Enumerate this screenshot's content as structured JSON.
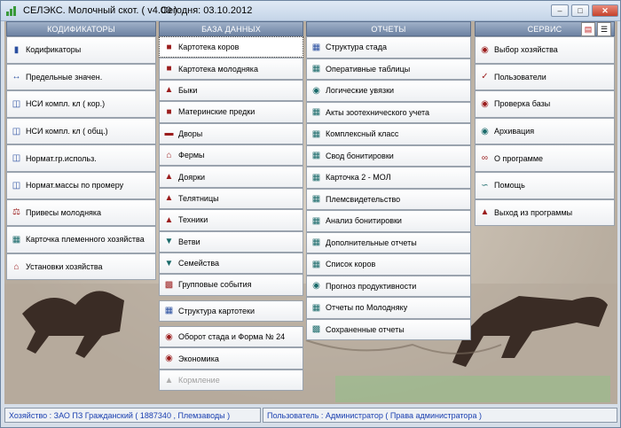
{
  "window": {
    "title": "СЕЛЭКС. Молочный скот. ( v4.00 )",
    "date": "Сегодня: 03.10.2012"
  },
  "columns": {
    "kodifikatory": {
      "header": "КОДИФИКАТОРЫ",
      "items": [
        {
          "label": "Кодификаторы",
          "icon": "books-icon"
        },
        {
          "label": "Предельные значен.",
          "icon": "range-icon"
        },
        {
          "label": "НСИ компл. кл ( кор.)",
          "icon": "book-icon"
        },
        {
          "label": "НСИ компл. кл ( общ.)",
          "icon": "book-icon"
        },
        {
          "label": "Нормат.гр.использ.",
          "icon": "book-icon"
        },
        {
          "label": "Нормат.массы по промеру",
          "icon": "book-icon"
        },
        {
          "label": "Привесы молодняка",
          "icon": "scales-icon"
        },
        {
          "label": "Карточка племенного хозяйства",
          "icon": "card-icon"
        },
        {
          "label": "Установки хозяйства",
          "icon": "farm-icon"
        }
      ]
    },
    "baza": {
      "header": "БАЗА ДАННЫХ",
      "items": [
        {
          "label": "Картотека коров",
          "icon": "cow-icon"
        },
        {
          "label": "Картотека молодняка",
          "icon": "calf-icon"
        },
        {
          "label": "Быки",
          "icon": "bull-icon"
        },
        {
          "label": "Материнские предки",
          "icon": "ancestors-icon"
        },
        {
          "label": "Дворы",
          "icon": "yard-icon"
        },
        {
          "label": "Фермы",
          "icon": "farm-icon"
        },
        {
          "label": "Доярки",
          "icon": "milkmaid-icon"
        },
        {
          "label": "Телятницы",
          "icon": "calf-keeper-icon"
        },
        {
          "label": "Техники",
          "icon": "technician-icon"
        },
        {
          "label": "Ветви",
          "icon": "branch-icon"
        },
        {
          "label": "Семейства",
          "icon": "family-icon"
        },
        {
          "label": "Групповые события",
          "icon": "group-events-icon"
        }
      ],
      "items2": [
        {
          "label": "Структура картотеки",
          "icon": "structure-icon"
        }
      ],
      "items3": [
        {
          "label": "Оборот стада и Форма № 24",
          "icon": "turnover-icon"
        },
        {
          "label": "Экономика",
          "icon": "economy-icon"
        },
        {
          "label": "Кормление",
          "icon": "feeding-icon"
        }
      ]
    },
    "otchety": {
      "header": "ОТЧЕТЫ",
      "items": [
        {
          "label": "Структура стада",
          "icon": "herd-structure-icon"
        },
        {
          "label": "Оперативные таблицы",
          "icon": "table-icon"
        },
        {
          "label": "Логические увязки",
          "icon": "logic-icon"
        },
        {
          "label": "Акты зоотехнического учета",
          "icon": "document-icon"
        },
        {
          "label": "Комплексный класс",
          "icon": "class-icon"
        },
        {
          "label": "Свод бонитировки",
          "icon": "summary-icon"
        },
        {
          "label": "Карточка 2 - МОЛ",
          "icon": "card-icon"
        },
        {
          "label": "Племсвидетельство",
          "icon": "certificate-icon"
        },
        {
          "label": "Анализ бонитировки",
          "icon": "analysis-icon"
        },
        {
          "label": "Дополнительные отчеты",
          "icon": "reports-icon"
        },
        {
          "label": "Список коров",
          "icon": "list-icon"
        },
        {
          "label": "Прогноз продуктивности",
          "icon": "forecast-icon"
        },
        {
          "label": "Отчеты по Молодняку",
          "icon": "young-report-icon"
        },
        {
          "label": "Сохраненные отчеты",
          "icon": "save-icon"
        }
      ]
    },
    "servis": {
      "header": "СЕРВИС",
      "items": [
        {
          "label": "Выбор хозяйства",
          "icon": "select-farm-icon"
        },
        {
          "label": "Пользователи",
          "icon": "users-icon"
        },
        {
          "label": "Проверка базы",
          "icon": "check-db-icon"
        },
        {
          "label": "Архивация",
          "icon": "archive-icon"
        },
        {
          "label": "О программе",
          "icon": "about-icon"
        },
        {
          "label": "Помощь",
          "icon": "help-icon"
        },
        {
          "label": "Выход из программы",
          "icon": "exit-icon"
        }
      ]
    }
  },
  "status": {
    "farm": "Хозяйство : ЗАО ПЗ Гражданский ( 1887340 , Племзаводы )",
    "user": "Пользователь : Администратор ( Права администратора )"
  },
  "colors": {
    "header_top": "#9fb0c8",
    "header_bottom": "#6e83a3",
    "status_text": "#1a3fb0",
    "icon_red": "#9b1d1d",
    "icon_blue": "#2a4fa0",
    "icon_teal": "#1a6a6a"
  }
}
